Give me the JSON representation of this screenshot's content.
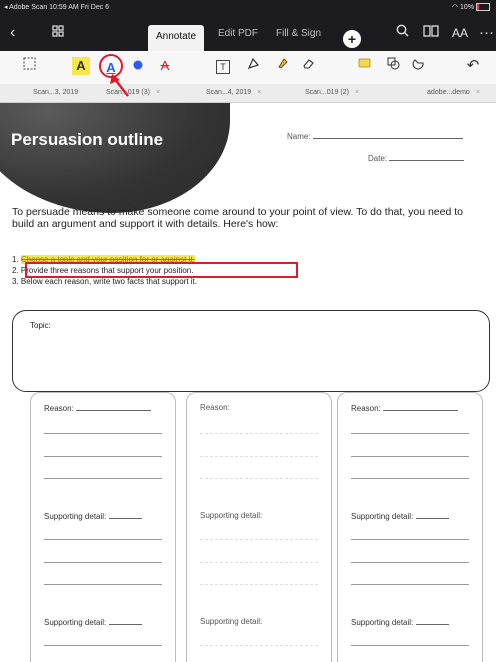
{
  "status_bar": {
    "left": "◂ Adobe Scan  10:59 AM  Fri Dec 6",
    "right": "10%"
  },
  "navbar": {
    "back_icon": "chevron-left-icon",
    "grid_icon": "grid-icon",
    "tabs": [
      "Annotate",
      "Edit PDF",
      "Fill & Sign"
    ],
    "active_tab": "Annotate",
    "add_icon": "plus-icon",
    "search_icon": "search-icon",
    "book_icon": "book-icon",
    "text_size_label": "AA",
    "more_icon": "ellipsis-icon"
  },
  "tools": [
    "select-box-icon",
    "highlight-text-icon",
    "underline-text-icon",
    "color-dot-icon",
    "strikethrough-icon",
    "text-box-icon",
    "draw-icon",
    "highlighter-icon",
    "eraser-icon",
    "comment-icon",
    "shapes-icon",
    "lasso-icon",
    "undo-icon"
  ],
  "tool_glyphs": {
    "highlight": "A",
    "underline": "A",
    "strike": "A",
    "text": "T"
  },
  "doc_tabs": [
    {
      "label": "Scan...3, 2019",
      "closable": false
    },
    {
      "label": "Scan...019 (3)",
      "closable": true
    },
    {
      "label": "Scan...4, 2019",
      "closable": true
    },
    {
      "label": "Scan...019 (2)",
      "closable": true
    },
    {
      "label": "adobe...demo",
      "closable": true
    }
  ],
  "document": {
    "title": "Persuasion outline",
    "name_label": "Name:",
    "date_label": "Date:",
    "intro": "To persuade means to make someone come around to your point of view. To do that, you need to build an argument and support it with details. Here's how:",
    "steps": [
      "Choose a topic and your position for or against it.",
      "Provide three reasons that support your position.",
      "Below each reason, write two facts that support it."
    ],
    "topic_label": "Topic:",
    "columns": [
      {
        "reason": "Reason:",
        "detail1": "Supporting detail:",
        "detail2": "Supporting detail:"
      },
      {
        "reason": "Reason:",
        "detail1": "Supporting detail:",
        "detail2": "Supporting detail:"
      },
      {
        "reason": "Reason:",
        "detail1": "Supporting detail:",
        "detail2": "Supporting detail:"
      }
    ]
  },
  "colors": {
    "annotation_red": "#e01a2a",
    "highlight_yellow": "#f6e74a",
    "selected_blue": "#2b5ef0"
  }
}
